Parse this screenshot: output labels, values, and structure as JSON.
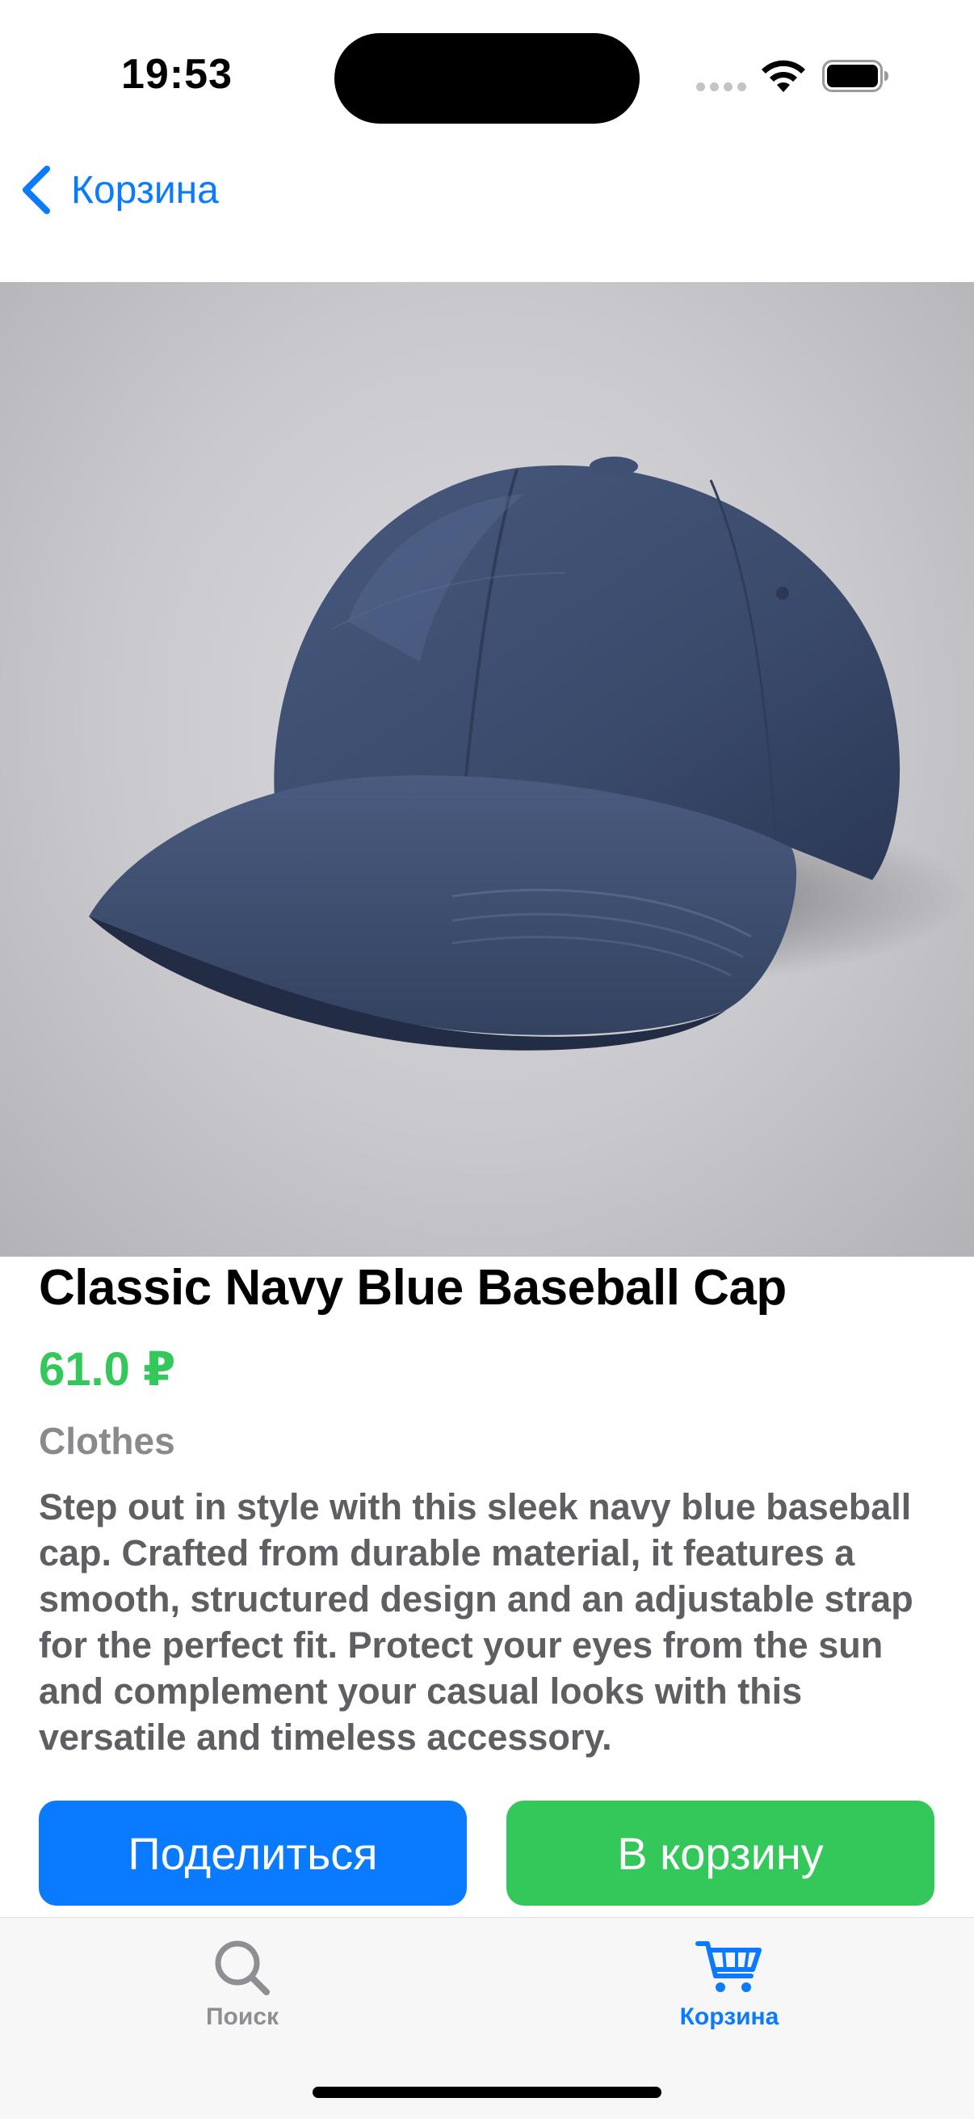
{
  "status_bar": {
    "time": "19:53"
  },
  "nav": {
    "back_label": "Корзина"
  },
  "product": {
    "image_icon": "navy-baseball-cap-photo",
    "title": "Classic Navy Blue Baseball Cap",
    "price": "61.0 ₽",
    "category": "Clothes",
    "description": "Step out in style with this sleek navy blue baseball cap. Crafted from durable material, it features a smooth, structured design and an adjustable strap for the perfect fit. Protect your eyes from the sun and complement your casual looks with this versatile and timeless accessory."
  },
  "actions": {
    "share_label": "Поделиться",
    "add_to_cart_label": "В корзину"
  },
  "tab_bar": {
    "items": [
      {
        "label": "Поиск",
        "icon": "magnifying-glass-icon",
        "active": false
      },
      {
        "label": "Корзина",
        "icon": "cart-icon",
        "active": true
      }
    ]
  },
  "colors": {
    "accent": "#0a7aff",
    "success": "#34c759",
    "secondary_text": "#8a8a8e",
    "body_text": "#5e5e63",
    "cap_navy": "#3a4a6b"
  }
}
